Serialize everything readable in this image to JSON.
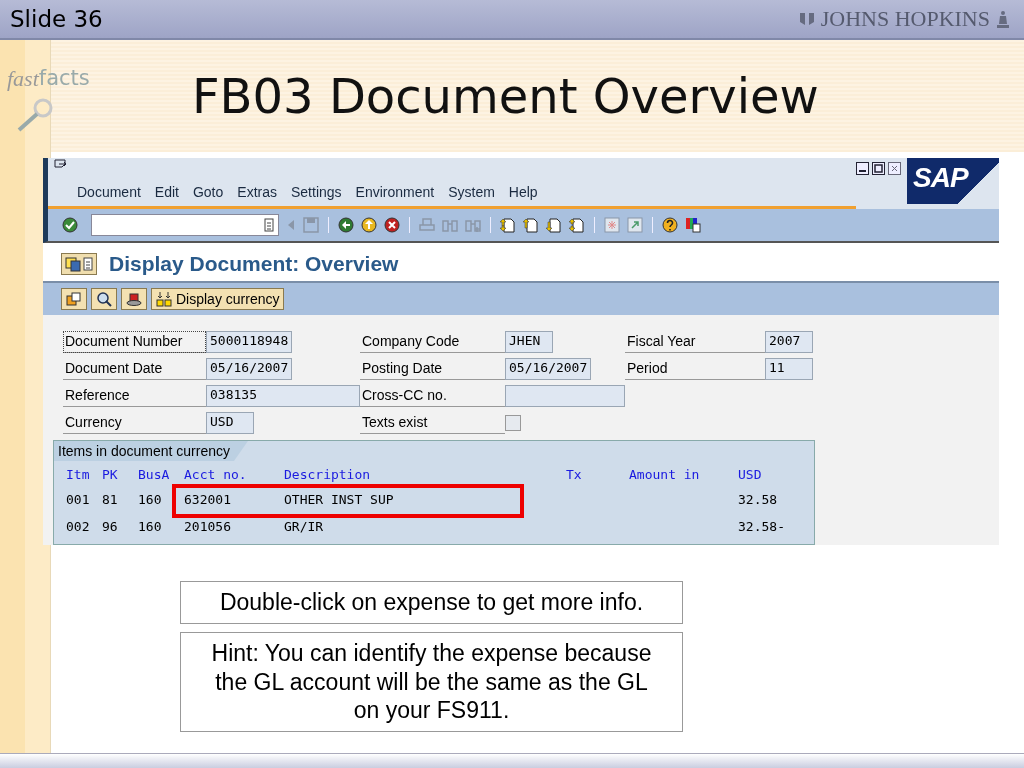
{
  "slide": {
    "number": "Slide 36",
    "brand": "JOHNS HOPKINS",
    "logo_words": [
      "fast",
      "facts"
    ],
    "title": "FB03 Document Overview"
  },
  "sap": {
    "menu": [
      "Document",
      "Edit",
      "Goto",
      "Extras",
      "Settings",
      "Environment",
      "System",
      "Help"
    ],
    "logo": "SAP",
    "screen_title": "Display Document: Overview",
    "toolbar_button": "Display currency",
    "header_rows": [
      [
        {
          "kind": "text",
          "label": "Document Number",
          "value": "5000118948",
          "focused": true
        },
        {
          "kind": "text",
          "label": "Company Code",
          "value": "JHEN"
        },
        {
          "kind": "text",
          "label": "Fiscal Year",
          "value": "2007"
        }
      ],
      [
        {
          "kind": "text",
          "label": "Document Date",
          "value": "05/16/2007"
        },
        {
          "kind": "text",
          "label": "Posting Date",
          "value": "05/16/2007"
        },
        {
          "kind": "text",
          "label": "Period",
          "value": "11"
        }
      ],
      [
        {
          "kind": "text",
          "label": "Reference",
          "value": "038135",
          "wide": true
        },
        {
          "kind": "text",
          "label": "Cross-CC no.",
          "wide": true
        }
      ],
      [
        {
          "kind": "text",
          "label": "Currency",
          "value": "USD"
        },
        {
          "kind": "checkbox",
          "label": "Texts exist",
          "checked": false
        }
      ]
    ],
    "items_tab": "Items in document currency",
    "columns": [
      "Itm",
      "PK",
      "BusA",
      "Acct no.",
      "Description",
      "Tx",
      "Amount in",
      "USD"
    ],
    "rows": [
      {
        "cells": [
          "001",
          "81",
          "160",
          "632001",
          "OTHER INST SUP",
          "",
          "",
          "32.58"
        ],
        "highlighted": true
      },
      {
        "cells": [
          "002",
          "96",
          "160",
          "201056",
          "GR/IR",
          "",
          "",
          "32.58-"
        ],
        "highlighted": false
      }
    ]
  },
  "callouts": [
    "Double-click on expense to get more info.",
    "Hint: You can identify the expense because the GL account will be the same as the GL on your FS911."
  ]
}
